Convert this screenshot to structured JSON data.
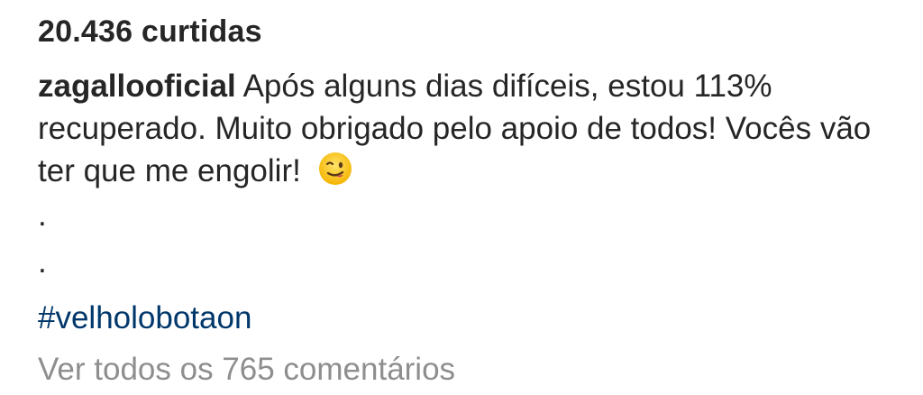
{
  "post": {
    "likes_text": "20.436 curtidas",
    "username": "zagallooficial",
    "caption_text": "Após alguns dias difíceis, estou 113% recuperado. Muito obrigado pelo apoio de todos! Vocês vão ter que me engolir!",
    "emoji": "wink-emoji",
    "dot_1": ".",
    "dot_2": ".",
    "hashtag": "#velholobotaon",
    "view_comments": "Ver todos os 765 comentários"
  },
  "colors": {
    "text": "#262626",
    "hashtag": "#00376b",
    "secondary": "#8e8e8e",
    "emoji_face": "#f7c928"
  }
}
